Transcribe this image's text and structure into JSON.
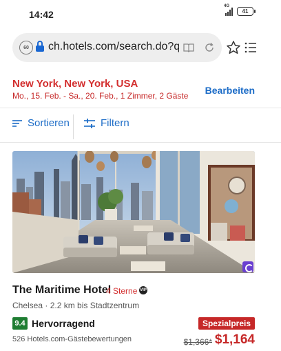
{
  "status_bar": {
    "time": "14:42",
    "network": "4G",
    "battery": "41"
  },
  "browser": {
    "url": "ch.hotels.com/search.do?q",
    "site_badge": "60"
  },
  "search": {
    "location": "New York, New York, USA",
    "dates": "Mo., 15. Feb. - Sa., 20. Feb., 1 Zimmer, 2 Gäste",
    "edit_label": "Bearbeiten"
  },
  "toolbar": {
    "sort_label": "Sortieren",
    "filter_label": "Filtern"
  },
  "hotel": {
    "name": "The Maritime Hotel",
    "stars": "4 Sterne",
    "neighborhood": "Chelsea · 2.2 km bis Stadtzentrum",
    "score": "9.4",
    "score_label": "Hervorragend",
    "reviews": "526 Hotels.com-Gästebewertungen",
    "deal": "Spezialpreis",
    "old_price": "$1,366*",
    "price": "$1,164"
  },
  "colors": {
    "accent_blue": "#1c6cc7",
    "price_red": "#c62828",
    "score_green": "#1e7d32"
  }
}
